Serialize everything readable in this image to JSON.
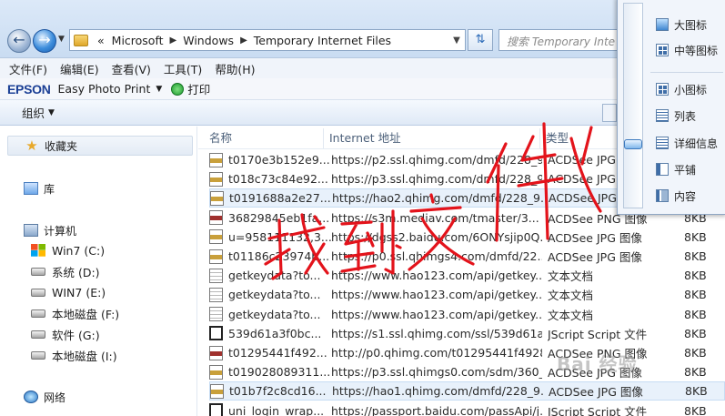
{
  "address": {
    "overflow": "«",
    "crumbs": [
      "Microsoft",
      "Windows",
      "Temporary Internet Files"
    ],
    "search_placeholder": "搜索 Temporary Inte"
  },
  "menubar": [
    "文件(F)",
    "编辑(E)",
    "查看(V)",
    "工具(T)",
    "帮助(H)"
  ],
  "epson": {
    "logo": "EPSON",
    "app": "Easy Photo Print",
    "print": "打印"
  },
  "toolbar": {
    "organize": "组织"
  },
  "sidebar": {
    "favorites": "收藏夹",
    "libraries": "库",
    "computer": "计算机",
    "drives": [
      "Win7 (C:)",
      "系统 (D:)",
      "WIN7 (E:)",
      "本地磁盘 (F:)",
      "软件 (G:)",
      "本地磁盘 (I:)"
    ],
    "network": "网络"
  },
  "columns": {
    "name": "名称",
    "address": "Internet 地址",
    "type": "类型"
  },
  "files": [
    {
      "name": "t0170e3b152e9...",
      "address": "https://p2.ssl.qhimg.com/dmfd/228_9...",
      "type": "ACDSee JPG",
      "size": "",
      "icon": "jpg"
    },
    {
      "name": "t018c73c84e92...",
      "address": "https://p3.ssl.qhimg.com/dmfd/228_9...",
      "type": "ACDSee JPG",
      "size": "",
      "icon": "jpg"
    },
    {
      "name": "t0191688a2e27...",
      "address": "https://hao2.qhimg.com/dmfd/228_9...",
      "type": "ACDSee JPG",
      "size": "",
      "icon": "jpg"
    },
    {
      "name": "36829845eb1fa...",
      "address": "https://s3m.mediav.com/tmaster/3...",
      "type": "ACDSee PNG 图像",
      "size": "8KB",
      "icon": "png"
    },
    {
      "name": "u=958111132,3...",
      "address": "https://dgss2.baidu.com/6ONYsjip0Q...",
      "type": "ACDSee JPG 图像",
      "size": "8KB",
      "icon": "jpg"
    },
    {
      "name": "t01186c23974b...",
      "address": "https://p0.ssl.qhimgs4.com/dmfd/22...",
      "type": "ACDSee JPG 图像",
      "size": "8KB",
      "icon": "jpg"
    },
    {
      "name": "getkeydata?to...",
      "address": "https://www.hao123.com/api/getkey...",
      "type": "文本文档",
      "size": "8KB",
      "icon": "txt"
    },
    {
      "name": "getkeydata?to...",
      "address": "https://www.hao123.com/api/getkey...",
      "type": "文本文档",
      "size": "8KB",
      "icon": "txt"
    },
    {
      "name": "getkeydata?to...",
      "address": "https://www.hao123.com/api/getkey...",
      "type": "文本文档",
      "size": "8KB",
      "icon": "txt"
    },
    {
      "name": "539d61a3f0bc...",
      "address": "https://s1.ssl.qhimg.com/ssl/539d61a...",
      "type": "JScript Script 文件",
      "size": "8KB",
      "icon": "js"
    },
    {
      "name": "t01295441f492...",
      "address": "http://p0.qhimg.com/t01295441f4928...",
      "type": "ACDSee PNG 图像",
      "size": "8KB",
      "icon": "png"
    },
    {
      "name": "t019028089311...",
      "address": "https://p3.ssl.qhimgs0.com/sdm/360_...",
      "type": "ACDSee JPG 图像",
      "size": "8KB",
      "icon": "jpg"
    },
    {
      "name": "t01b7f2c8cd16...",
      "address": "https://hao1.qhimg.com/dmfd/228_9...",
      "type": "ACDSee JPG 图像",
      "size": "8KB",
      "icon": "jpg"
    },
    {
      "name": "uni_login_wrap...",
      "address": "https://passport.baidu.com/passApi/j...",
      "type": "JScript Script 文件",
      "size": "8KB",
      "icon": "js"
    }
  ],
  "view_menu": [
    "大图标",
    "中等图标",
    "小图标",
    "列表",
    "详细信息",
    "平铺",
    "内容"
  ],
  "annotation": "找到文件",
  "watermark": "Bai 经验"
}
